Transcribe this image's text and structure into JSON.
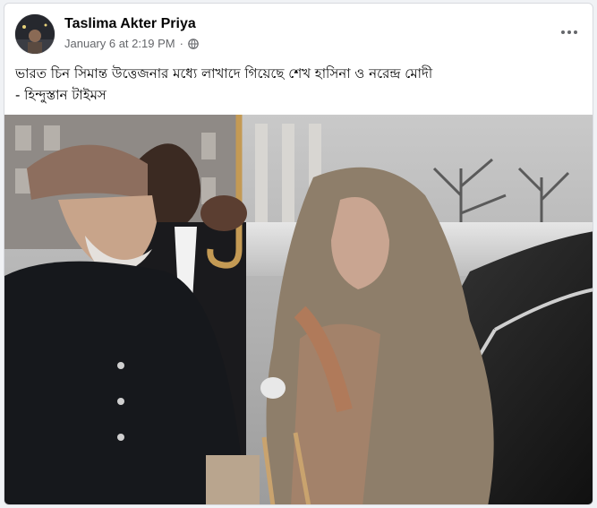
{
  "post": {
    "author": "Taslima Akter Priya",
    "date": "January 6 at 2:19 PM",
    "separator": "·",
    "privacy_icon": "globe-icon",
    "more_icon": "more-options-icon",
    "caption_line1": "ভারত চিন সিমান্ত উত্তেজনার মধ্যে লাখাদে গিয়েছে শেখ হাসিনা ও নরেন্দ্র মোদী",
    "caption_line2": "- হিন্দুস্তান টাইমস"
  },
  "colors": {
    "background": "#f0f2f5",
    "card": "#ffffff",
    "text_primary": "#050505",
    "text_secondary": "#65676b"
  }
}
